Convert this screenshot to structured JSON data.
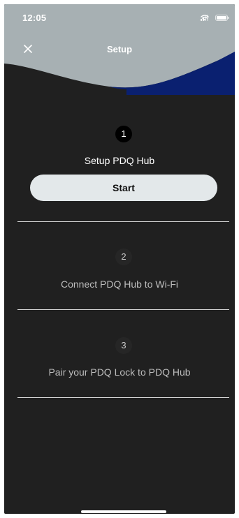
{
  "status_bar": {
    "time": "12:05"
  },
  "nav": {
    "title": "Setup",
    "close_icon": "close-icon"
  },
  "steps": [
    {
      "number": "1",
      "label": "Setup PDQ Hub",
      "active": true
    },
    {
      "number": "2",
      "label": "Connect PDQ Hub to Wi-Fi",
      "active": false
    },
    {
      "number": "3",
      "label": "Pair your PDQ Lock to PDQ Hub",
      "active": false
    }
  ],
  "start_button": {
    "label": "Start"
  },
  "colors": {
    "background": "#202020",
    "header_gray": "#a7b0b3",
    "header_navy": "#0a2070",
    "button_bg": "#e3e8ea"
  }
}
